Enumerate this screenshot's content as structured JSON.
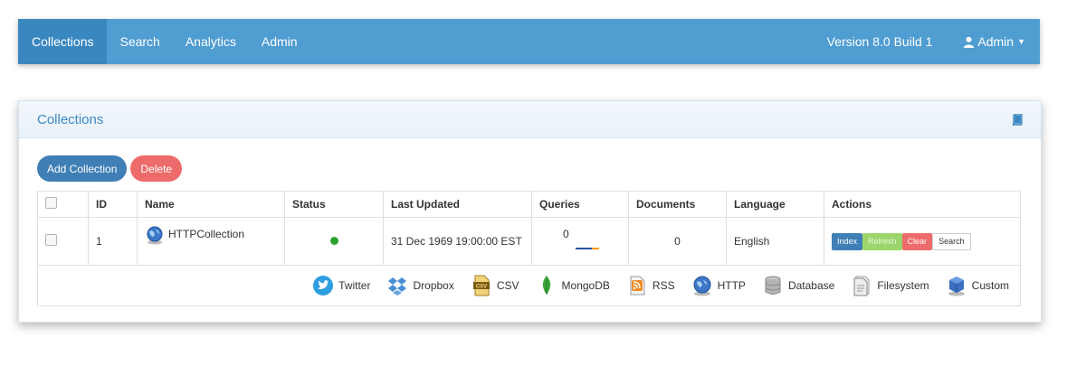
{
  "nav": {
    "items": [
      {
        "label": "Collections",
        "active": true
      },
      {
        "label": "Search",
        "active": false
      },
      {
        "label": "Analytics",
        "active": false
      },
      {
        "label": "Admin",
        "active": false
      }
    ],
    "version": "Version 8.0 Build 1",
    "user_menu": "Admin",
    "colors": {
      "bar": "#4f9dd1",
      "active": "#3a87c0"
    }
  },
  "panel": {
    "title": "Collections",
    "buttons": {
      "add": "Add Collection",
      "delete": "Delete"
    }
  },
  "table": {
    "headers": [
      "ID",
      "Name",
      "Status",
      "Last Updated",
      "Queries",
      "Documents",
      "Language",
      "Actions"
    ],
    "rows": [
      {
        "id": "1",
        "name": "HTTPCollection",
        "status": "active",
        "status_color": "#2ca02c",
        "last_updated": "31 Dec 1969 19:00:00 EST",
        "queries": "0",
        "documents": "0",
        "language": "English",
        "actions": [
          "Index",
          "Refresh",
          "Clear",
          "Search"
        ]
      }
    ]
  },
  "sources": [
    {
      "label": "Twitter",
      "icon": "twitter-icon"
    },
    {
      "label": "Dropbox",
      "icon": "dropbox-icon"
    },
    {
      "label": "CSV",
      "icon": "csv-icon"
    },
    {
      "label": "MongoDB",
      "icon": "mongodb-icon"
    },
    {
      "label": "RSS",
      "icon": "rss-icon"
    },
    {
      "label": "HTTP",
      "icon": "http-globe-icon"
    },
    {
      "label": "Database",
      "icon": "database-icon"
    },
    {
      "label": "Filesystem",
      "icon": "filesystem-icon"
    },
    {
      "label": "Custom",
      "icon": "custom-cube-icon"
    }
  ]
}
